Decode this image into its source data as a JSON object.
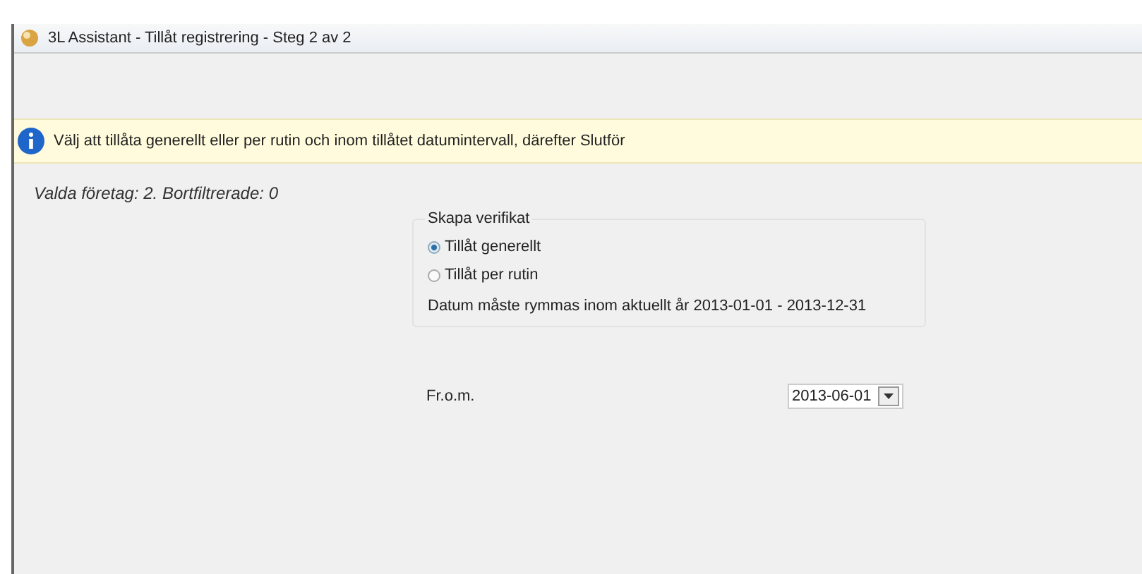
{
  "window": {
    "title": "3L Assistant - Tillåt registrering - Steg 2 av 2"
  },
  "info_bar": {
    "text": "Välj att tillåta generellt eller per rutin och inom tillåtet datumintervall, därefter Slutför"
  },
  "summary": "Valda företag: 2. Bortfiltrerade: 0",
  "group": {
    "title": "Skapa verifikat",
    "options": [
      {
        "label": "Tillåt generellt",
        "selected": true
      },
      {
        "label": "Tillåt per rutin",
        "selected": false
      }
    ],
    "note": "Datum måste rymmas inom aktuellt år 2013-01-01 - 2013-12-31"
  },
  "from_date": {
    "label": "Fr.o.m.",
    "value": "2013-06-01"
  }
}
